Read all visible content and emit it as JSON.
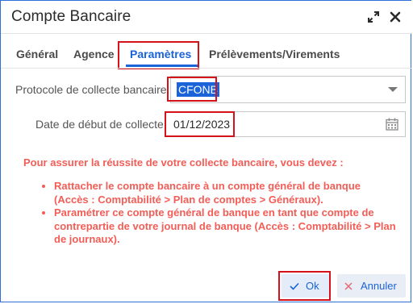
{
  "dialog": {
    "title": "Compte Bancaire"
  },
  "tabs": [
    {
      "label": "Général"
    },
    {
      "label": "Agence"
    },
    {
      "label": "Paramètres"
    },
    {
      "label": "Prélèvements/Virements"
    }
  ],
  "active_tab": "Paramètres",
  "form": {
    "protocole_label": "Protocole de collecte bancaire:",
    "protocole_value": "CFONB",
    "date_label": "Date de début de collecte:",
    "date_value": "01/12/2023"
  },
  "info": {
    "title": "Pour assurer la réussite de votre collecte bancaire, vous devez :",
    "items": [
      "Rattacher le compte bancaire à un compte général de banque (Accès : Comptabilité > Plan de comptes > Généraux).",
      "Paramétrer ce compte général de banque en tant que compte de contrepartie de votre journal de banque (Accès : Comptabilité > Plan de journaux)."
    ]
  },
  "buttons": {
    "ok_label": "Ok",
    "cancel_label": "Annuler"
  },
  "icons": {
    "expand": "expand-icon",
    "close": "close-icon",
    "dropdown": "chevron-down-icon",
    "calendar": "calendar-icon",
    "check": "check-icon",
    "cancel": "x-icon"
  },
  "colors": {
    "accent": "#1a63d8",
    "warning_text": "#f25e57",
    "highlight_box": "#d3121a"
  }
}
